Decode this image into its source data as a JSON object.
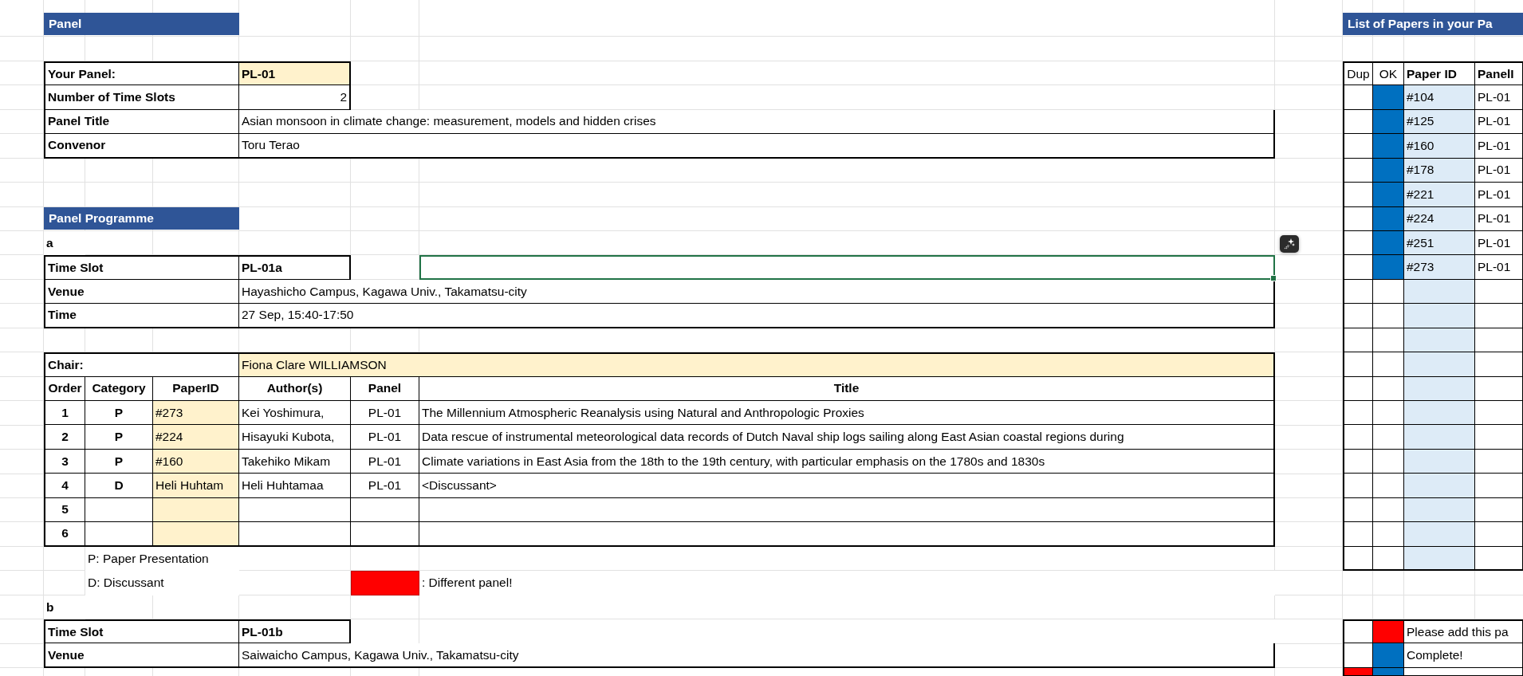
{
  "panel_header": "Panel",
  "panel_info": [
    {
      "label": "Your Panel:",
      "value": "PL-01",
      "kind": "input"
    },
    {
      "label": "Number of Time Slots",
      "value": "2",
      "kind": "number"
    },
    {
      "label": "Panel Title",
      "value": "Asian monsoon in climate change: measurement, models and hidden crises",
      "kind": "text"
    },
    {
      "label": "Convenor",
      "value": "Toru Terao",
      "kind": "text"
    }
  ],
  "programme_header": "Panel Programme",
  "slots": [
    {
      "letter": "a",
      "note_selected": true,
      "fields": [
        {
          "label": "Time Slot",
          "value": "PL-01a",
          "kind": "code"
        },
        {
          "label": "Venue",
          "value": "Hayashicho Campus, Kagawa Univ., Takamatsu-city",
          "kind": "text"
        },
        {
          "label": "Time",
          "value": "27 Sep, 15:40-17:50",
          "kind": "text"
        }
      ],
      "chair": {
        "label": "Chair:",
        "value": "Fiona Clare WILLIAMSON"
      },
      "columns": [
        "Order",
        "Category",
        "PaperID",
        "Author(s)",
        "Panel",
        "Title"
      ],
      "rows": [
        {
          "order": "1",
          "category": "P",
          "paper_id": "#273",
          "authors": "Kei Yoshimura,",
          "panel": "PL-01",
          "title": "The Millennium Atmospheric Reanalysis using Natural and Anthropologic Proxies"
        },
        {
          "order": "2",
          "category": "P",
          "paper_id": "#224",
          "authors": "Hisayuki Kubota,",
          "panel": "PL-01",
          "title": "Data rescue of instrumental meteorological data records of Dutch Naval ship logs sailing along East Asian coastal regions during"
        },
        {
          "order": "3",
          "category": "P",
          "paper_id": "#160",
          "authors": "Takehiko Mikam",
          "panel": "PL-01",
          "title": "Climate variations in East Asia from the 18th to the 19th century, with particular emphasis on the 1780s and 1830s"
        },
        {
          "order": "4",
          "category": "D",
          "paper_id": "Heli Huhtam",
          "authors": "Heli Huhtamaa",
          "panel": "PL-01",
          "title": "<Discussant>"
        },
        {
          "order": "5"
        },
        {
          "order": "6"
        }
      ],
      "legend": [
        "P: Paper Presentation",
        "D: Discussant"
      ],
      "color_key": {
        "color": "#ff0000",
        "text": ": Different panel!"
      }
    },
    {
      "letter": "b",
      "note_selected": false,
      "fields": [
        {
          "label": "Time Slot",
          "value": "PL-01b",
          "kind": "code"
        },
        {
          "label": "Venue",
          "value": "Saiwaicho Campus, Kagawa Univ., Takamatsu-city",
          "kind": "text"
        }
      ]
    }
  ],
  "paper_list": {
    "header": "List of Papers in your Pa",
    "columns": [
      "Dup",
      "OK",
      "Paper ID",
      "PanelI"
    ],
    "rows": [
      {
        "dup": false,
        "ok": true,
        "paper_id": "#104",
        "panel": "PL-01"
      },
      {
        "dup": false,
        "ok": true,
        "paper_id": "#125",
        "panel": "PL-01"
      },
      {
        "dup": false,
        "ok": true,
        "paper_id": "#160",
        "panel": "PL-01"
      },
      {
        "dup": false,
        "ok": true,
        "paper_id": "#178",
        "panel": "PL-01"
      },
      {
        "dup": false,
        "ok": true,
        "paper_id": "#221",
        "panel": "PL-01"
      },
      {
        "dup": false,
        "ok": true,
        "paper_id": "#224",
        "panel": "PL-01"
      },
      {
        "dup": false,
        "ok": true,
        "paper_id": "#251",
        "panel": "PL-01"
      },
      {
        "dup": false,
        "ok": true,
        "paper_id": "#273",
        "panel": "PL-01"
      },
      {
        "dup": false,
        "ok": false
      },
      {
        "dup": false,
        "ok": false
      },
      {
        "dup": false,
        "ok": false
      },
      {
        "dup": false,
        "ok": false
      },
      {
        "dup": false,
        "ok": false
      },
      {
        "dup": false,
        "ok": false
      },
      {
        "dup": false,
        "ok": false
      },
      {
        "dup": false,
        "ok": false
      },
      {
        "dup": false,
        "ok": false
      },
      {
        "dup": false,
        "ok": false
      },
      {
        "dup": false,
        "ok": false
      },
      {
        "dup": false,
        "ok": false
      }
    ],
    "status_key": [
      {
        "color": "#ff0000",
        "text": "Please add this pa"
      },
      {
        "color": "#0070c0",
        "text": "Complete!"
      },
      {
        "color": "#0070c0",
        "dup": {
          "color": "#ff0000"
        }
      }
    ]
  }
}
